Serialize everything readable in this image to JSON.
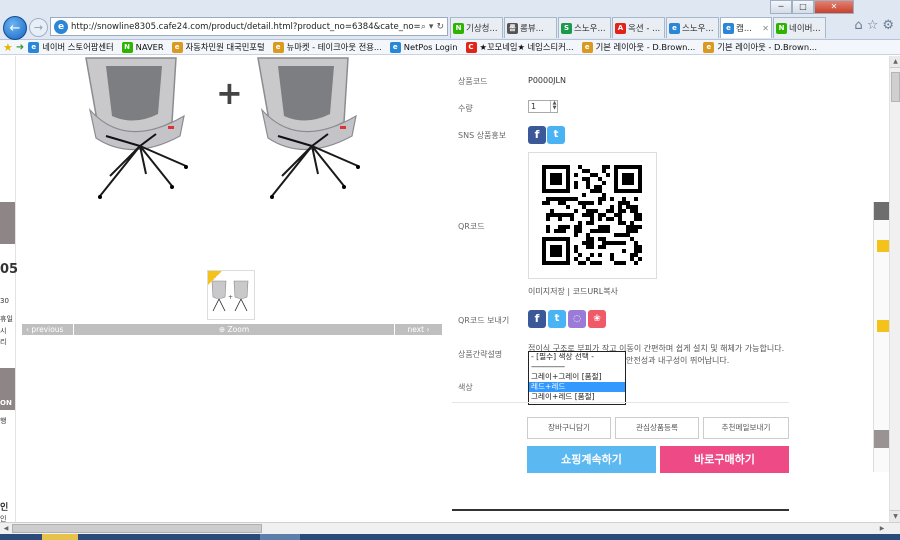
{
  "browser": {
    "url": "http://snowline8305.cafe24.com/product/detail.html?product_no=6384&cate_no=89&di",
    "tabs": [
      {
        "label": "기상청...",
        "icon": "N",
        "color": "#2db400",
        "active": false
      },
      {
        "label": "롬뷰...",
        "icon": "롬",
        "color": "#555555",
        "active": false
      },
      {
        "label": "스노우...",
        "icon": "S",
        "color": "#1a9a4a",
        "active": false
      },
      {
        "label": "옥션 - ...",
        "icon": "A",
        "color": "#e2231a",
        "active": false
      },
      {
        "label": "스노우...",
        "icon": "e",
        "color": "#2a86d6",
        "active": false
      },
      {
        "label": "캠...",
        "icon": "e",
        "color": "#2a86d6",
        "active": true
      },
      {
        "label": "네이버...",
        "icon": "N",
        "color": "#2db400",
        "active": false
      }
    ],
    "favorites": [
      {
        "label": "네이버 스토어팜센터",
        "icon": "e",
        "color": "#2a86d6"
      },
      {
        "label": "NAVER",
        "icon": "N",
        "color": "#2db400"
      },
      {
        "label": "자동차민원 대국민포털",
        "icon": "e",
        "color": "#d99a1f"
      },
      {
        "label": "뉴마켓 - 테이크아웃 전용...",
        "icon": "e",
        "color": "#d99a1f"
      },
      {
        "label": "NetPos Login",
        "icon": "e",
        "color": "#2a86d6"
      },
      {
        "label": "★꼬모네임★ 네임스티커...",
        "icon": "C",
        "color": "#e2231a"
      },
      {
        "label": "기본 레이아웃 - D.Brown...",
        "icon": "e",
        "color": "#d99a1f"
      },
      {
        "label": "기본 레이아웃 - D.Brown...",
        "icon": "e",
        "color": "#d99a1f"
      }
    ]
  },
  "gallery": {
    "prev_label": "previous",
    "zoom_label": "Zoom",
    "next_label": "next"
  },
  "left_fragments": {
    "num": "05",
    "a": "30",
    "b": "휴일",
    "c": "시",
    "d": "리",
    "e": "ON",
    "f": "행",
    "g": "인",
    "h": "인"
  },
  "product": {
    "code_label": "상품코드",
    "code_value": "P0000JLN",
    "qty_label": "수량",
    "qty_value": "1",
    "sns_label": "SNS 상품홍보",
    "qr_label": "QR코드",
    "qr_save": "이미지저장",
    "qr_divider": "|",
    "qr_copy": "코드URL복사",
    "qr_send_label": "QR코드 보내기",
    "desc_label": "상품간략설명",
    "desc_text_1": "접이식 구조로 부피가 작고 이동이 간편하며 쉽게 설치 및 해체가 가능합니다.",
    "desc_text_2": "안전성과 내구성이 뛰어납니다.",
    "color_label": "색상"
  },
  "color_select": {
    "options": [
      {
        "label": "- [필수] 색상 선택 -",
        "selected": false
      },
      {
        "label": "-------------------",
        "selected": false
      },
      {
        "label": "그레이+그레이 [품절]",
        "selected": false
      },
      {
        "label": "레드+레드",
        "selected": true
      },
      {
        "label": "그레이+레드 [품절]",
        "selected": false
      }
    ]
  },
  "actions": {
    "cart_small": "장바구니담기",
    "wishlist": "관심상품등록",
    "send_mail": "추천메일보내기",
    "continue": "쇼핑계속하기",
    "buy_now": "바로구매하기"
  },
  "colors": {
    "cart_button": "#5bb8f0",
    "buy_button": "#ee4a86",
    "selected_option": "#3399ff"
  }
}
